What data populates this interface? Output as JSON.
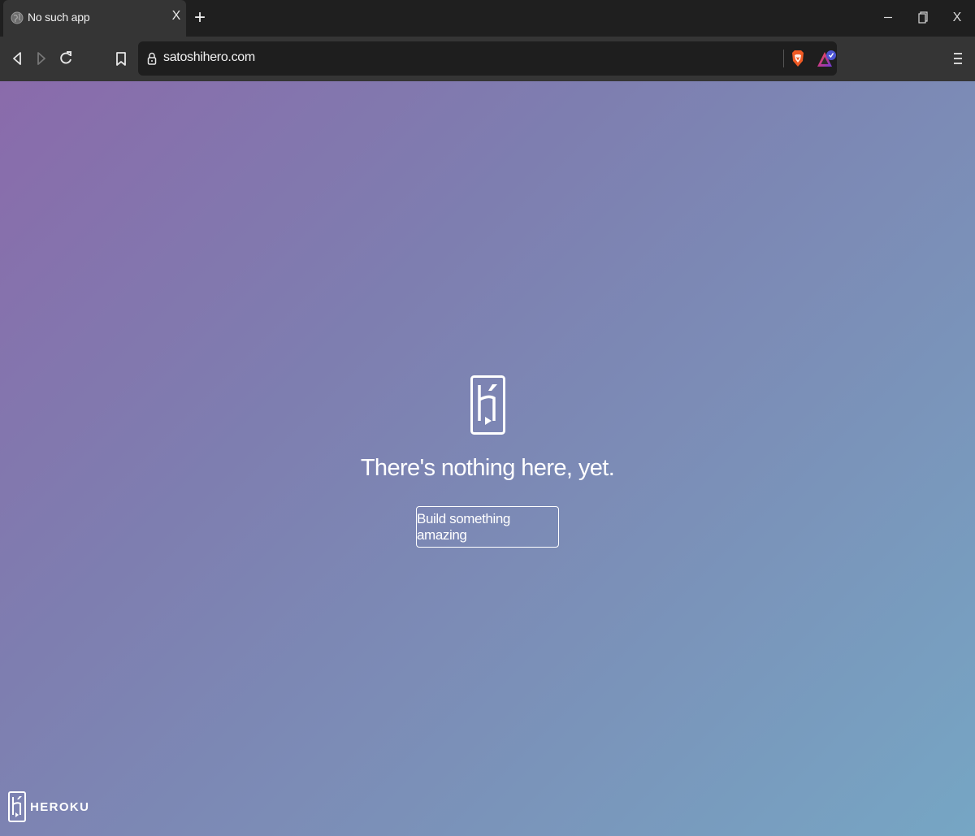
{
  "browser": {
    "tab": {
      "title": "No such app",
      "close_label": "X"
    },
    "new_tab_label": "+",
    "window": {
      "minimize_label": "–",
      "close_label": "X"
    },
    "address_bar": {
      "url": "satoshihero.com"
    }
  },
  "page": {
    "headline": "There's nothing here, yet.",
    "cta_label": "Build something amazing",
    "footer_brand": "HEROKU"
  },
  "colors": {
    "gradient_start": "#8a6bab",
    "gradient_end": "#76a6c4",
    "chrome_dark": "#1f1f1f",
    "chrome_mid": "#353535",
    "brave_orange": "#f05a24"
  }
}
